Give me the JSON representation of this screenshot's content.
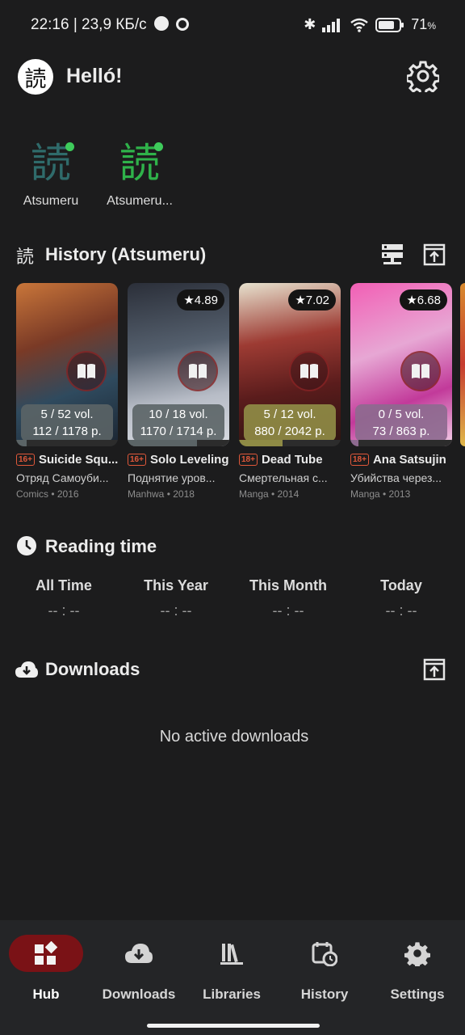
{
  "status_bar": {
    "time": "22:16 | 23,9 КБ/с",
    "battery": "71"
  },
  "header": {
    "logo_glyph": "読",
    "greeting": "Helló!"
  },
  "sources": [
    {
      "glyph": "読",
      "name": "Atsumeru",
      "color": "#2f6b6b"
    },
    {
      "glyph": "読",
      "name": "Atsumeru...",
      "color": "#2fb24a"
    }
  ],
  "history": {
    "title": "History (Atsumeru)",
    "icon_glyph": "読",
    "items": [
      {
        "title": "Suicide Squ...",
        "subtitle": "Отряд Самоуби...",
        "meta": "Comics • 2016",
        "age": "16+",
        "rating": "",
        "vols": "5 / 52 vol.",
        "pages": "112 / 1178 p.",
        "progress": 0.1,
        "accent": "#5b6466",
        "cover_bg": "linear-gradient(160deg,#c9763a 0%,#7a3a26 35%,#2f4a5e 65%,#1b2531 100%)"
      },
      {
        "title": "Solo Leveling",
        "subtitle": "Поднятие уров...",
        "meta": "Manhwa • 2018",
        "age": "16+",
        "rating": "★4.89",
        "vols": "10 / 18 vol.",
        "pages": "1170 / 1714 p.",
        "progress": 0.68,
        "accent": "#5b6466",
        "cover_bg": "linear-gradient(170deg,#2b2f39 0%,#55606e 40%,#b7bcc6 70%,#dadde3 100%)"
      },
      {
        "title": "Dead Tube",
        "subtitle": "Смертельная с...",
        "meta": "Manga • 2014",
        "age": "18+",
        "rating": "★7.02",
        "vols": "5 / 12 vol.",
        "pages": "880 / 2042 p.",
        "progress": 0.43,
        "accent": "#8f8b45",
        "cover_bg": "linear-gradient(170deg,#e7e2cf 0%,#9d3b33 35%,#5a1c1c 65%,#2b1410 100%)"
      },
      {
        "title": "Ana Satsujin",
        "subtitle": "Убийства через...",
        "meta": "Manga • 2013",
        "age": "18+",
        "rating": "★6.68",
        "vols": "0 / 5 vol.",
        "pages": "73 / 863 p.",
        "progress": 0.08,
        "accent": "#8d6a8f",
        "cover_bg": "linear-gradient(160deg,#f25fb5 0%,#e7a7d4 40%,#c23a9a 70%,#f4d3ea 100%)"
      }
    ]
  },
  "reading_time": {
    "title": "Reading time",
    "columns": [
      {
        "label": "All Time",
        "value": "-- : --"
      },
      {
        "label": "This Year",
        "value": "-- : --"
      },
      {
        "label": "This Month",
        "value": "-- : --"
      },
      {
        "label": "Today",
        "value": "-- : --"
      }
    ]
  },
  "downloads": {
    "title": "Downloads",
    "empty": "No active downloads"
  },
  "nav": {
    "active_color": "#7a1216",
    "items": [
      {
        "label": "Hub",
        "icon": "hub-icon"
      },
      {
        "label": "Downloads",
        "icon": "cloud-download-icon"
      },
      {
        "label": "Libraries",
        "icon": "libraries-icon"
      },
      {
        "label": "History",
        "icon": "history-icon"
      },
      {
        "label": "Settings",
        "icon": "gear-icon"
      }
    ]
  }
}
